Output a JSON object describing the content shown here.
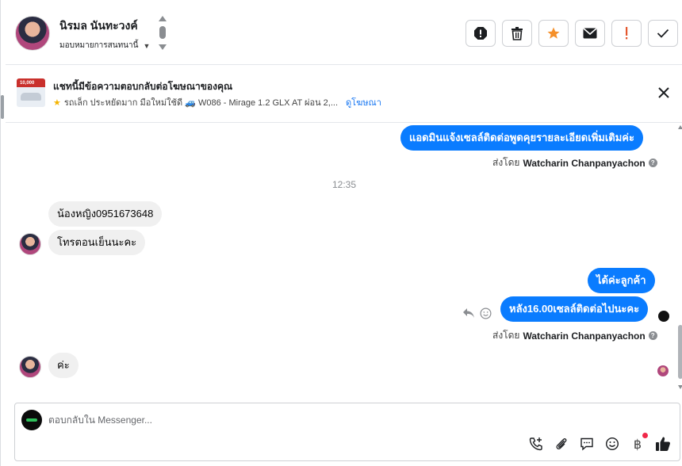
{
  "header": {
    "contact_name": "นิรมล นันทะวงค์",
    "assign_label": "มอบหมายการสนทนานี้",
    "actions": [
      {
        "name": "spam-icon",
        "tooltip": ""
      },
      {
        "name": "trash-icon"
      },
      {
        "name": "star-icon"
      },
      {
        "name": "envelope-icon"
      },
      {
        "name": "important-icon"
      },
      {
        "name": "check-icon"
      }
    ]
  },
  "ad": {
    "title": "แชทนี้มีข้อความตอบกลับต่อโฆษณาของคุณ",
    "subtitle": "รถเล็ก ประหยัดมาก มือใหม่ใช้ดี 🚙 W086 - Mirage 1.2 GLX AT ผ่อน 2,...",
    "thumb_price": "10,000",
    "link_label": "ดูโฆษณา"
  },
  "chat": {
    "msg_out_1": "แอดมินแจ้งเซลล์ติดต่อพูดคุยรายละเอียดเพิ่มเติมค่ะ",
    "sent_by_prefix": "ส่งโดย",
    "sent_by_name": "Watcharin Chanpanyachon",
    "timestamp": "12:35",
    "msg_in_1": "น้องหญิง0951673648",
    "msg_in_2": "โทรตอนเย็นนะคะ",
    "msg_out_2": "ได้ค่ะลูกค้า",
    "msg_out_3": "หลัง16.00เซลล์ติดต่อไปนะคะ",
    "msg_in_3": "ค่ะ"
  },
  "composer": {
    "placeholder": "ตอบกลับใน Messenger...",
    "baht_symbol": "฿"
  },
  "colors": {
    "accent": "#0a7cff",
    "star": "#f5902a",
    "important": "#e4572e"
  }
}
